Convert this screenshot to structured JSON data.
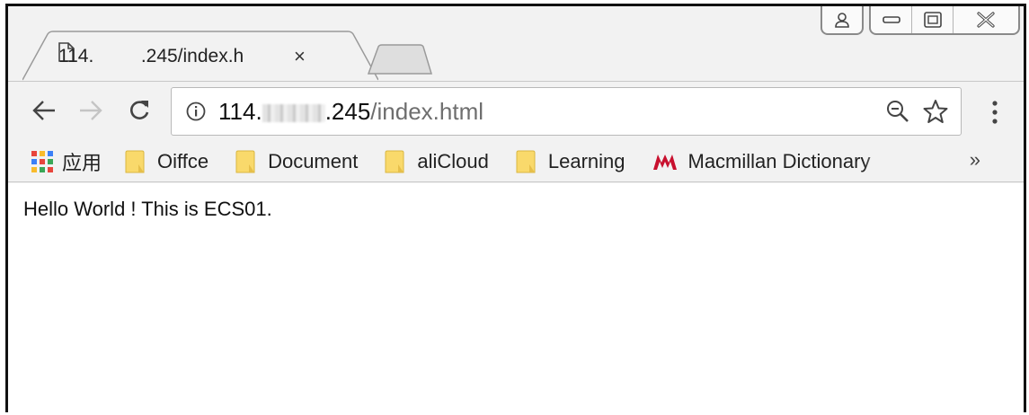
{
  "tab": {
    "title": "114.     .245/index.h",
    "close_glyph": "×"
  },
  "address": {
    "host_prefix": "114.",
    "host_suffix": ".245",
    "path": "/index.html"
  },
  "bookmarks": {
    "apps_label": "应用",
    "items": [
      {
        "label": "Oiffce"
      },
      {
        "label": "Document"
      },
      {
        "label": "aliCloud"
      },
      {
        "label": "Learning"
      }
    ],
    "macmillan_label": "Macmillan Dictionary",
    "overflow_glyph": "»"
  },
  "page": {
    "text": "Hello World ! This is ECS01."
  },
  "icons": {
    "back": "arrow-left-icon",
    "forward": "arrow-right-icon",
    "reload": "reload-icon",
    "info": "info-icon",
    "zoom": "zoom-out-icon",
    "star": "star-icon",
    "menu": "kebab-menu-icon"
  },
  "colors": {
    "folder": "#f9d96b",
    "macmillan": "#c8102e",
    "path": "#6e6e6e"
  }
}
